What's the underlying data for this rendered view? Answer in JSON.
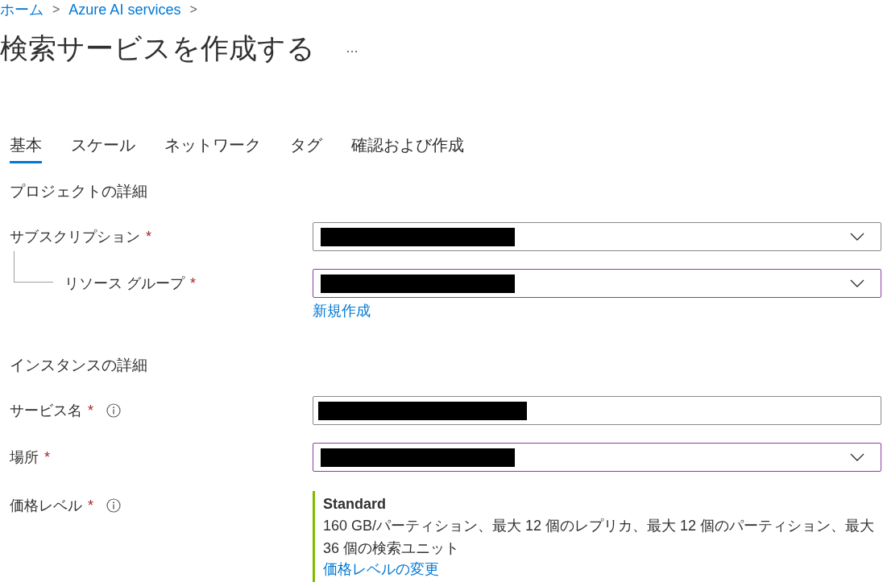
{
  "breadcrumb": [
    {
      "label": "ホーム",
      "separator": ">"
    },
    {
      "label": "Azure AI services",
      "separator": ">"
    }
  ],
  "title": "検索サービスを作成する",
  "more_button": "…",
  "tabs": [
    {
      "label": "基本",
      "selected": true
    },
    {
      "label": "スケール",
      "selected": false
    },
    {
      "label": "ネットワーク",
      "selected": false
    },
    {
      "label": "タグ",
      "selected": false
    },
    {
      "label": "確認および作成",
      "selected": false
    }
  ],
  "sections": [
    {
      "heading": "プロジェクトの詳細",
      "fields": [
        {
          "label": "サブスクリプション",
          "required_mark": "*",
          "info": false,
          "nested": false,
          "kind": "dropdown",
          "highlighted": false,
          "redacted": true
        },
        {
          "label": "リソース グループ",
          "required_mark": "*",
          "info": false,
          "nested": true,
          "kind": "dropdown",
          "highlighted": true,
          "redacted": true,
          "link": "新規作成"
        }
      ]
    },
    {
      "heading": "インスタンスの詳細",
      "fields": [
        {
          "label": "サービス名",
          "required_mark": "*",
          "info": true,
          "nested": false,
          "kind": "text",
          "highlighted": false,
          "redacted": true
        },
        {
          "label": "場所",
          "required_mark": "*",
          "info": false,
          "nested": false,
          "kind": "dropdown",
          "highlighted": true,
          "redacted": true
        },
        {
          "label": "価格レベル",
          "required_mark": "*",
          "info": true,
          "nested": false,
          "kind": "pricing",
          "tier": "Standard",
          "description": "160 GB/パーティション、最大 12 個のレプリカ、最大 12 個のパーティション、最大 36 個の検索ユニット",
          "link": "価格レベルの変更"
        }
      ]
    }
  ]
}
